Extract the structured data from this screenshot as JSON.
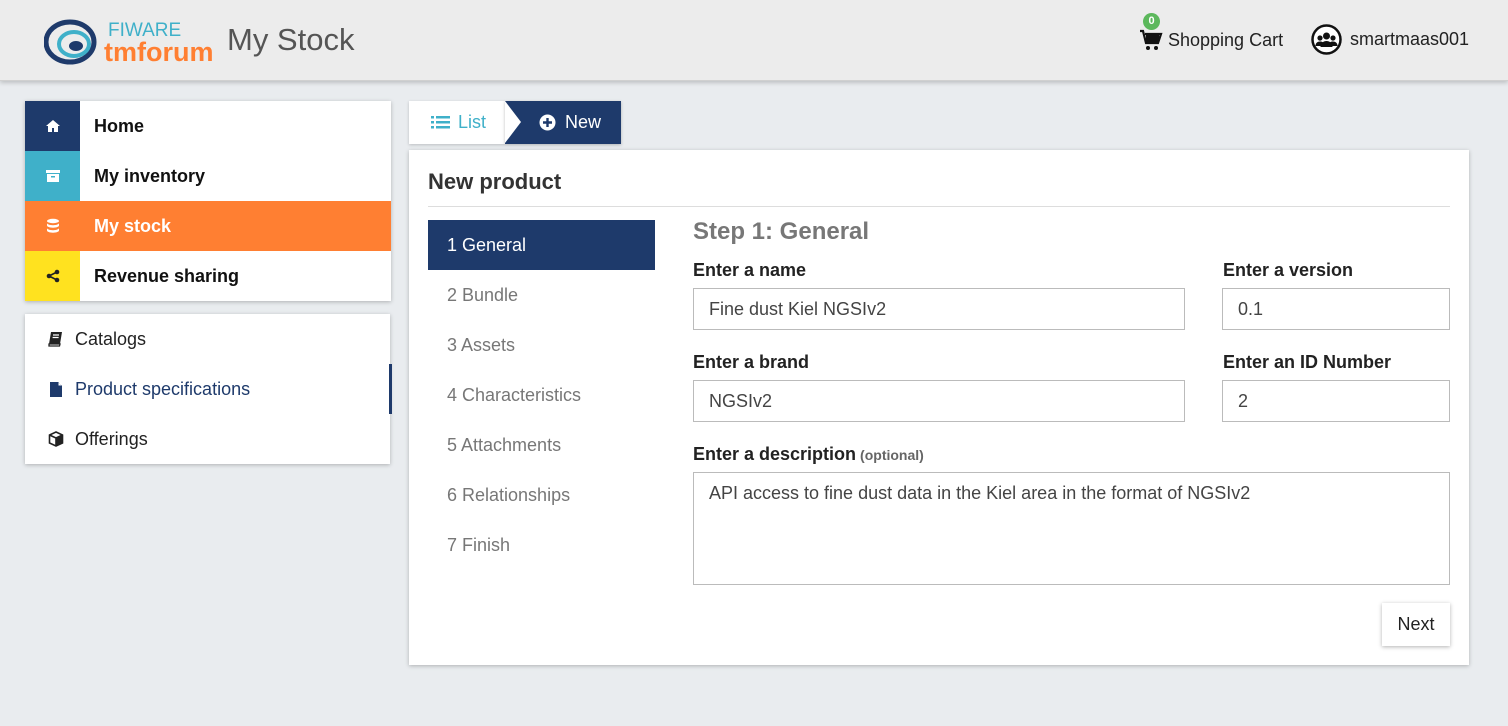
{
  "header": {
    "logo_text_top": "FIWARE",
    "logo_text_bottom": "tmforum",
    "title": "My Stock",
    "cart_count": "0",
    "cart_label": "Shopping Cart",
    "user_name": "smartmaas001"
  },
  "nav": {
    "items": [
      {
        "label": "Home",
        "icon": "home-icon",
        "color": "#1e3a6b"
      },
      {
        "label": "My inventory",
        "icon": "archive-icon",
        "color": "#3fb0c9"
      },
      {
        "label": "My stock",
        "icon": "database-icon",
        "color": "#ff7f32"
      },
      {
        "label": "Revenue sharing",
        "icon": "share-icon",
        "color": "#ffe21f"
      }
    ],
    "sub_items": [
      {
        "label": "Catalogs",
        "icon": "book-icon"
      },
      {
        "label": "Product specifications",
        "icon": "file-icon"
      },
      {
        "label": "Offerings",
        "icon": "cube-icon"
      }
    ]
  },
  "breadcrumb": {
    "list_label": "List",
    "new_label": "New"
  },
  "panel": {
    "title": "New product",
    "steps": [
      "1 General",
      "2 Bundle",
      "3 Assets",
      "4 Characteristics",
      "5 Attachments",
      "6 Relationships",
      "7 Finish"
    ],
    "step_title": "Step 1: General",
    "fields": {
      "name_label": "Enter a name",
      "name_value": "Fine dust Kiel NGSIv2",
      "version_label": "Enter a version",
      "version_value": "0.1",
      "brand_label": "Enter a brand",
      "brand_value": "NGSIv2",
      "id_label": "Enter an ID Number",
      "id_value": "2",
      "description_label": "Enter a description",
      "description_optional": "(optional)",
      "description_value": "API access to fine dust data in the Kiel area in the format of NGSIv2"
    },
    "next_label": "Next"
  },
  "colors": {
    "primary": "#1e3a6b",
    "accent_orange": "#ff7f32",
    "accent_cyan": "#3fb0c9",
    "accent_yellow": "#ffe21f",
    "badge_green": "#5cb85c"
  }
}
